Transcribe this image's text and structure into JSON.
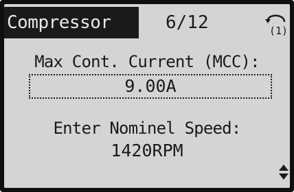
{
  "header": {
    "title": "Compressor",
    "page_counter": "6/12",
    "back_icon": "back-arrow-icon",
    "back_badge": "(1)"
  },
  "parameter": {
    "label": "Max Cont. Current (MCC):",
    "value": "9.00A"
  },
  "info": {
    "label": "Enter Nominel Speed:",
    "value": "1420RPM"
  },
  "footer": {
    "scroll_icon": "up-down-arrows-icon"
  },
  "colors": {
    "screen_bg": "#d4d4d4",
    "text": "#1a1a1a",
    "highlight_bg": "#1a1a1a",
    "highlight_text": "#e8e8e8",
    "bezel": "#0f0f0f"
  }
}
